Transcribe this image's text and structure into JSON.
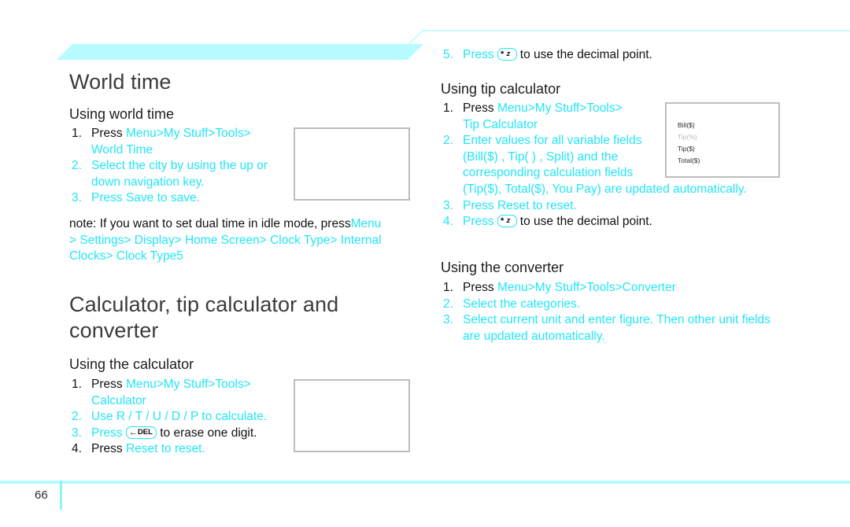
{
  "page": {
    "number": "66",
    "accent_color": "#23e5f5",
    "rule_color": "#b6fbff",
    "heading_color": "#3b3b3b"
  },
  "left_column": {
    "chapter_title": "World time",
    "world_time": {
      "section_title": "Using world time",
      "steps": [
        {
          "num": "1.",
          "num_color": "black",
          "parts": [
            {
              "text": "Press ",
              "color": "black"
            },
            {
              "text": "Menu",
              "color": "cyan"
            },
            {
              "text": " > ",
              "color": "cyan"
            },
            {
              "text": "My Stuff",
              "color": "cyan"
            },
            {
              "text": " > ",
              "color": "cyan"
            },
            {
              "text": "Tools",
              "color": "cyan"
            },
            {
              "text": " >",
              "color": "cyan"
            }
          ],
          "continuation": "World Time"
        },
        {
          "num": "2.",
          "num_color": "cyan",
          "parts": [
            {
              "text": "Select the city by using the up or",
              "color": "cyan"
            }
          ],
          "continuation": "down navigation key."
        },
        {
          "num": "3.",
          "num_color": "cyan",
          "parts": [
            {
              "text": "Press ",
              "color": "cyan"
            },
            {
              "text": "Save",
              "color": "cyan"
            },
            {
              "text": " to save.",
              "color": "cyan"
            }
          ],
          "continuation": ""
        }
      ],
      "note": {
        "label": "note:",
        "body_black": "If you want to set dual time in idle mode, press",
        "path": [
          "Menu",
          "Settings",
          "Display",
          "Home Screen",
          "Clock Type",
          "Internal Clocks",
          "Clock Type5"
        ],
        "separator": ">"
      },
      "screenshot": {
        "name": "world-time-phone-screenshot",
        "lines": []
      }
    },
    "calculator": {
      "chapter_title": "Calculator, tip calculator and converter",
      "section_title": "Using the calculator",
      "steps": [
        {
          "num": "1.",
          "num_color": "black",
          "parts": [
            {
              "text": "Press ",
              "color": "black"
            },
            {
              "text": "Menu",
              "color": "cyan"
            },
            {
              "text": " > ",
              "color": "cyan"
            },
            {
              "text": "My Stuff",
              "color": "cyan"
            },
            {
              "text": " > ",
              "color": "cyan"
            },
            {
              "text": "Tools",
              "color": "cyan"
            },
            {
              "text": " >",
              "color": "cyan"
            }
          ],
          "continuation": "Calculator"
        },
        {
          "num": "2.",
          "num_color": "cyan",
          "parts": [
            {
              "text": "Use ",
              "color": "cyan"
            },
            {
              "text": "R / T / U / D / P",
              "color": "cyan"
            },
            {
              "text": "  to calculate.",
              "color": "cyan"
            }
          ],
          "continuation": ""
        },
        {
          "num": "3.",
          "num_color": "cyan",
          "key": {
            "type": "del-key",
            "glyph": "←",
            "label": "DEL"
          },
          "prefix": "Press ",
          "suffix": " to erase one digit.",
          "suffix_color": "black"
        },
        {
          "num": "4.",
          "num_color": "black",
          "parts": [
            {
              "text": "Press ",
              "color": "black"
            },
            {
              "text": "Reset",
              "color": "cyan"
            },
            {
              "text": " to reset.",
              "color": "cyan"
            }
          ],
          "continuation": ""
        }
      ],
      "screenshot": {
        "name": "calculator-phone-screenshot",
        "lines": []
      }
    }
  },
  "right_column": {
    "calculator_continued": {
      "step": {
        "num": "5.",
        "num_color": "cyan",
        "prefix": "Press ",
        "key": {
          "type": "star-key",
          "glyph": "*",
          "label": "z"
        },
        "suffix": " to use the decimal point.",
        "suffix_color": "black"
      }
    },
    "tip_calculator": {
      "section_title": "Using tip calculator",
      "steps": [
        {
          "num": "1.",
          "num_color": "black",
          "parts": [
            {
              "text": "Press ",
              "color": "black"
            },
            {
              "text": "Menu",
              "color": "cyan"
            },
            {
              "text": " > ",
              "color": "cyan"
            },
            {
              "text": "My Stuff",
              "color": "cyan"
            },
            {
              "text": " > ",
              "color": "cyan"
            },
            {
              "text": "Tools",
              "color": "cyan"
            },
            {
              "text": " >",
              "color": "cyan"
            }
          ],
          "continuation": "Tip Calculator"
        },
        {
          "num": "2.",
          "num_color": "cyan",
          "lines": [
            "Enter values for all variable fields",
            "(Bill($) , Tip( ) , Split) and the",
            "corresponding calculation fields",
            "(Tip($), Total($), You Pay) are updated automatically."
          ]
        },
        {
          "num": "3.",
          "num_color": "cyan",
          "parts": [
            {
              "text": "Press ",
              "color": "cyan"
            },
            {
              "text": "Reset",
              "color": "cyan"
            },
            {
              "text": " to reset.",
              "color": "cyan"
            }
          ],
          "continuation": ""
        },
        {
          "num": "4.",
          "num_color": "cyan",
          "prefix": "Press ",
          "key": {
            "type": "star-key",
            "glyph": "*",
            "label": "z"
          },
          "suffix": " to use the decimal point.",
          "suffix_color": "black"
        }
      ],
      "screenshot": {
        "name": "tip-calculator-phone-screenshot",
        "lines": [
          "Bill($)",
          "Tip(%)",
          "Tip($)",
          "Total($)"
        ]
      }
    },
    "converter": {
      "section_title": "Using the converter",
      "steps": [
        {
          "num": "1.",
          "num_color": "black",
          "parts": [
            {
              "text": "Press ",
              "color": "black"
            },
            {
              "text": "Menu",
              "color": "cyan"
            },
            {
              "text": " > ",
              "color": "cyan"
            },
            {
              "text": "My Stuff",
              "color": "cyan"
            },
            {
              "text": " > ",
              "color": "cyan"
            },
            {
              "text": "Tools",
              "color": "cyan"
            },
            {
              "text": " > ",
              "color": "cyan"
            },
            {
              "text": "Converter",
              "color": "cyan"
            }
          ]
        },
        {
          "num": "2.",
          "num_color": "cyan",
          "text": "Select the categories."
        },
        {
          "num": "3.",
          "num_color": "cyan",
          "lines": [
            "Select current unit and enter figure. Then other unit fields",
            "are updated automatically."
          ]
        }
      ]
    }
  },
  "strings": {
    "world_step1_press": "Press ",
    "world_step1_menu": "Menu",
    "world_step1_gt1": ">",
    "world_step1_mystuff": "My Stuff",
    "world_step1_gt2": ">",
    "world_step1_tools": "Tools",
    "world_step1_gt3": ">",
    "world_step1_cont": "World Time",
    "world_step2": "Select the city by using the up or",
    "world_step2_cont": "down navigation key.",
    "world_step3_press": "Press ",
    "world_step3_save": "Save",
    "world_step3_tail": " to save.",
    "note_label": "note:",
    "note_body": "If you want to set dual time in idle mode, press",
    "note_menu": "Menu",
    "note_settings": "Settings",
    "note_display": "Display",
    "note_homescreen": "Home Screen",
    "note_clocktype": "Clock Type",
    "note_internalclocks": "Internal Clocks",
    "note_clocktype5": "Clock Type5",
    "gt": ">",
    "calc_title": "Calculator, tip calculator and converter",
    "calc_section": "Using the calculator",
    "calc_step1_press": "Press ",
    "calc_step1_cont": "Calculator",
    "calc_step2_use": "Use ",
    "calc_step2_keys": "R / T / U / D / P",
    "calc_step2_tail": "  to calculate.",
    "calc_step3_press": "Press ",
    "calc_step3_tail": " to erase one digit.",
    "calc_step4_press": "Press ",
    "calc_step4_reset": "Reset",
    "calc_step4_tail": " to reset.",
    "calc_step5_press": "Press ",
    "calc_step5_tail": " to use the decimal point.",
    "tip_section": "Using tip calculator",
    "tip_step1_press": "Press ",
    "tip_step1_cont": "Tip Calculator",
    "tip_step2_l1": "Enter values for all variable fields",
    "tip_step2_l2": "(Bill($) , Tip( ) , Split) and the",
    "tip_step2_l3": "corresponding calculation fields",
    "tip_step2_l4": "(Tip($), Total($), You Pay) are updated automatically.",
    "tip_step3_press": "Press ",
    "tip_step3_reset": "Reset",
    "tip_step3_tail": " to reset.",
    "tip_step4_press": "Press ",
    "tip_step4_tail": " to use the decimal point.",
    "conv_section": "Using the converter",
    "conv_step1_press": "Press ",
    "conv_step1_converter": "Converter",
    "conv_step2": "Select the categories.",
    "conv_step3_l1": "Select current unit and enter figure. Then other unit fields",
    "conv_step3_l2": "are updated automatically.",
    "menu": "Menu",
    "mystuff": "My Stuff",
    "tools": "Tools",
    "key_star": "*",
    "key_star_sub": "z",
    "key_del_arrow": "←",
    "key_del_label": "DEL",
    "shot_bill": "Bill($)",
    "shot_tippct": "Tip(%)",
    "shot_tipdollar": "Tip($)",
    "shot_total": "Total($)"
  }
}
